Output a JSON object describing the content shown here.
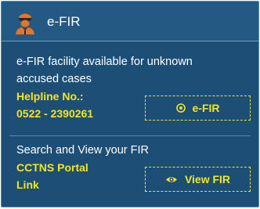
{
  "header": {
    "title": "e-FIR",
    "icon": "police-officer-icon"
  },
  "efir_section": {
    "description_line1": "e-FIR facility available for unknown",
    "description_line2": "accused cases",
    "helpline_label": "Helpline No.:",
    "helpline_number": "0522 - 2390261",
    "button_label": "e-FIR",
    "button_icon": "target-circle-icon"
  },
  "fir_section": {
    "description": "Search and View your FIR",
    "portal_line1": "CCTNS Portal",
    "portal_line2": "Link",
    "button_label": "View FIR",
    "button_icon": "eye-icon"
  },
  "colors": {
    "card_background": "#1d4f76",
    "header_background": "#245983",
    "accent_yellow": "#f5e421",
    "text_white": "#ffffff",
    "icon_orange": "#e8742a"
  }
}
